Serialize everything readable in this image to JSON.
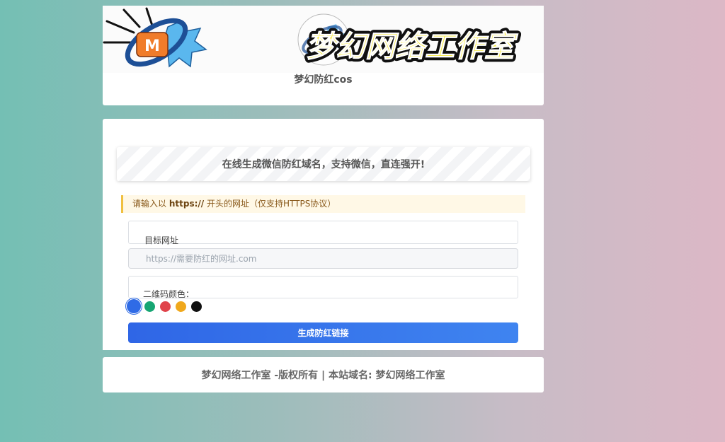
{
  "header": {
    "banner_text": "梦幻网络工作室",
    "site_title": "梦幻防红cos"
  },
  "main": {
    "slogan": "在线生成微信防红域名，支持微信，直连强开!",
    "notice": {
      "prefix": "请输入以",
      "highlight": "https://",
      "suffix": "开头的网址（仅支持HTTPS协议）"
    },
    "url_label": "目标网址",
    "url_placeholder": "https://需要防红的网址.com",
    "color_label": "二维码颜色：",
    "colors": [
      "#2f6be6",
      "#17a673",
      "#e0434a",
      "#f0a81c",
      "#111111"
    ],
    "selected_color_index": 0,
    "generate_button": "生成防红链接"
  },
  "footer": {
    "text": "梦幻网络工作室 -版权所有 | 本站域名: 梦幻网络工作室"
  }
}
